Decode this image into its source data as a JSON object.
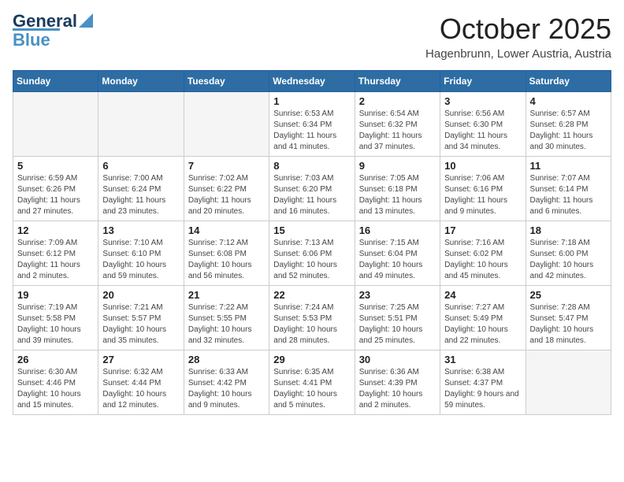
{
  "logo": {
    "line1": "General",
    "line2": "Blue"
  },
  "header": {
    "month": "October 2025",
    "location": "Hagenbrunn, Lower Austria, Austria"
  },
  "weekdays": [
    "Sunday",
    "Monday",
    "Tuesday",
    "Wednesday",
    "Thursday",
    "Friday",
    "Saturday"
  ],
  "weeks": [
    [
      {
        "day": "",
        "sunrise": "",
        "sunset": "",
        "daylight": ""
      },
      {
        "day": "",
        "sunrise": "",
        "sunset": "",
        "daylight": ""
      },
      {
        "day": "",
        "sunrise": "",
        "sunset": "",
        "daylight": ""
      },
      {
        "day": "1",
        "sunrise": "Sunrise: 6:53 AM",
        "sunset": "Sunset: 6:34 PM",
        "daylight": "Daylight: 11 hours and 41 minutes."
      },
      {
        "day": "2",
        "sunrise": "Sunrise: 6:54 AM",
        "sunset": "Sunset: 6:32 PM",
        "daylight": "Daylight: 11 hours and 37 minutes."
      },
      {
        "day": "3",
        "sunrise": "Sunrise: 6:56 AM",
        "sunset": "Sunset: 6:30 PM",
        "daylight": "Daylight: 11 hours and 34 minutes."
      },
      {
        "day": "4",
        "sunrise": "Sunrise: 6:57 AM",
        "sunset": "Sunset: 6:28 PM",
        "daylight": "Daylight: 11 hours and 30 minutes."
      }
    ],
    [
      {
        "day": "5",
        "sunrise": "Sunrise: 6:59 AM",
        "sunset": "Sunset: 6:26 PM",
        "daylight": "Daylight: 11 hours and 27 minutes."
      },
      {
        "day": "6",
        "sunrise": "Sunrise: 7:00 AM",
        "sunset": "Sunset: 6:24 PM",
        "daylight": "Daylight: 11 hours and 23 minutes."
      },
      {
        "day": "7",
        "sunrise": "Sunrise: 7:02 AM",
        "sunset": "Sunset: 6:22 PM",
        "daylight": "Daylight: 11 hours and 20 minutes."
      },
      {
        "day": "8",
        "sunrise": "Sunrise: 7:03 AM",
        "sunset": "Sunset: 6:20 PM",
        "daylight": "Daylight: 11 hours and 16 minutes."
      },
      {
        "day": "9",
        "sunrise": "Sunrise: 7:05 AM",
        "sunset": "Sunset: 6:18 PM",
        "daylight": "Daylight: 11 hours and 13 minutes."
      },
      {
        "day": "10",
        "sunrise": "Sunrise: 7:06 AM",
        "sunset": "Sunset: 6:16 PM",
        "daylight": "Daylight: 11 hours and 9 minutes."
      },
      {
        "day": "11",
        "sunrise": "Sunrise: 7:07 AM",
        "sunset": "Sunset: 6:14 PM",
        "daylight": "Daylight: 11 hours and 6 minutes."
      }
    ],
    [
      {
        "day": "12",
        "sunrise": "Sunrise: 7:09 AM",
        "sunset": "Sunset: 6:12 PM",
        "daylight": "Daylight: 11 hours and 2 minutes."
      },
      {
        "day": "13",
        "sunrise": "Sunrise: 7:10 AM",
        "sunset": "Sunset: 6:10 PM",
        "daylight": "Daylight: 10 hours and 59 minutes."
      },
      {
        "day": "14",
        "sunrise": "Sunrise: 7:12 AM",
        "sunset": "Sunset: 6:08 PM",
        "daylight": "Daylight: 10 hours and 56 minutes."
      },
      {
        "day": "15",
        "sunrise": "Sunrise: 7:13 AM",
        "sunset": "Sunset: 6:06 PM",
        "daylight": "Daylight: 10 hours and 52 minutes."
      },
      {
        "day": "16",
        "sunrise": "Sunrise: 7:15 AM",
        "sunset": "Sunset: 6:04 PM",
        "daylight": "Daylight: 10 hours and 49 minutes."
      },
      {
        "day": "17",
        "sunrise": "Sunrise: 7:16 AM",
        "sunset": "Sunset: 6:02 PM",
        "daylight": "Daylight: 10 hours and 45 minutes."
      },
      {
        "day": "18",
        "sunrise": "Sunrise: 7:18 AM",
        "sunset": "Sunset: 6:00 PM",
        "daylight": "Daylight: 10 hours and 42 minutes."
      }
    ],
    [
      {
        "day": "19",
        "sunrise": "Sunrise: 7:19 AM",
        "sunset": "Sunset: 5:58 PM",
        "daylight": "Daylight: 10 hours and 39 minutes."
      },
      {
        "day": "20",
        "sunrise": "Sunrise: 7:21 AM",
        "sunset": "Sunset: 5:57 PM",
        "daylight": "Daylight: 10 hours and 35 minutes."
      },
      {
        "day": "21",
        "sunrise": "Sunrise: 7:22 AM",
        "sunset": "Sunset: 5:55 PM",
        "daylight": "Daylight: 10 hours and 32 minutes."
      },
      {
        "day": "22",
        "sunrise": "Sunrise: 7:24 AM",
        "sunset": "Sunset: 5:53 PM",
        "daylight": "Daylight: 10 hours and 28 minutes."
      },
      {
        "day": "23",
        "sunrise": "Sunrise: 7:25 AM",
        "sunset": "Sunset: 5:51 PM",
        "daylight": "Daylight: 10 hours and 25 minutes."
      },
      {
        "day": "24",
        "sunrise": "Sunrise: 7:27 AM",
        "sunset": "Sunset: 5:49 PM",
        "daylight": "Daylight: 10 hours and 22 minutes."
      },
      {
        "day": "25",
        "sunrise": "Sunrise: 7:28 AM",
        "sunset": "Sunset: 5:47 PM",
        "daylight": "Daylight: 10 hours and 18 minutes."
      }
    ],
    [
      {
        "day": "26",
        "sunrise": "Sunrise: 6:30 AM",
        "sunset": "Sunset: 4:46 PM",
        "daylight": "Daylight: 10 hours and 15 minutes."
      },
      {
        "day": "27",
        "sunrise": "Sunrise: 6:32 AM",
        "sunset": "Sunset: 4:44 PM",
        "daylight": "Daylight: 10 hours and 12 minutes."
      },
      {
        "day": "28",
        "sunrise": "Sunrise: 6:33 AM",
        "sunset": "Sunset: 4:42 PM",
        "daylight": "Daylight: 10 hours and 9 minutes."
      },
      {
        "day": "29",
        "sunrise": "Sunrise: 6:35 AM",
        "sunset": "Sunset: 4:41 PM",
        "daylight": "Daylight: 10 hours and 5 minutes."
      },
      {
        "day": "30",
        "sunrise": "Sunrise: 6:36 AM",
        "sunset": "Sunset: 4:39 PM",
        "daylight": "Daylight: 10 hours and 2 minutes."
      },
      {
        "day": "31",
        "sunrise": "Sunrise: 6:38 AM",
        "sunset": "Sunset: 4:37 PM",
        "daylight": "Daylight: 9 hours and 59 minutes."
      },
      {
        "day": "",
        "sunrise": "",
        "sunset": "",
        "daylight": ""
      }
    ]
  ]
}
